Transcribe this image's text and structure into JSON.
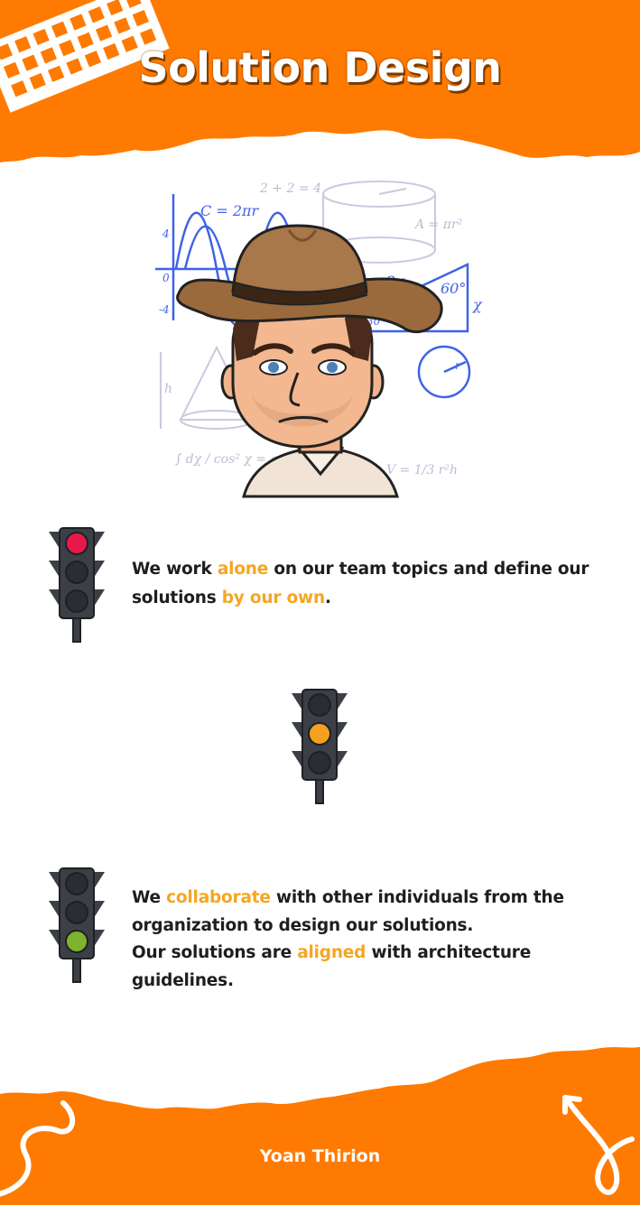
{
  "header": {
    "title": "Solution Design"
  },
  "hero": {
    "formula_circumference": "C = 2πr",
    "formula_sum": "2 + 2 = 4",
    "formula_area": "A = πr²",
    "label_2x": "2χ",
    "label_60": "60°",
    "label_x": "χ",
    "label_30": "30°",
    "label_h": "h",
    "label_r": "r",
    "formula_integral": "∫ dχ / cos² χ = a",
    "formula_volume": "V = 1/3 r²h",
    "axis_4": "4",
    "axis_0": "0",
    "axis_neg4": "-4"
  },
  "levels": [
    {
      "state": "red",
      "segments": [
        {
          "text": "We work ",
          "highlight": false
        },
        {
          "text": "alone",
          "highlight": true
        },
        {
          "text": " on our team topics and define our",
          "highlight": false
        },
        {
          "text": "\n",
          "highlight": false
        },
        {
          "text": "solutions ",
          "highlight": false
        },
        {
          "text": "by our own",
          "highlight": true
        },
        {
          "text": ".",
          "highlight": false
        }
      ]
    },
    {
      "state": "amber",
      "segments": []
    },
    {
      "state": "green",
      "segments": [
        {
          "text": "We ",
          "highlight": false
        },
        {
          "text": "collaborate",
          "highlight": true
        },
        {
          "text": " with other individuals from the",
          "highlight": false
        },
        {
          "text": "\n",
          "highlight": false
        },
        {
          "text": "organization to design our solutions.",
          "highlight": false
        },
        {
          "text": "\n",
          "highlight": false
        },
        {
          "text": "Our solutions are ",
          "highlight": false
        },
        {
          "text": "aligned",
          "highlight": true
        },
        {
          "text": " with architecture guidelines.",
          "highlight": false
        }
      ]
    }
  ],
  "colors": {
    "orange": "#ff7a00",
    "highlight": "#f5a623",
    "red_light": "#e8194a",
    "amber_light": "#f5a01f",
    "green_light": "#7cb32f"
  },
  "footer": {
    "author": "Yoan Thirion"
  }
}
